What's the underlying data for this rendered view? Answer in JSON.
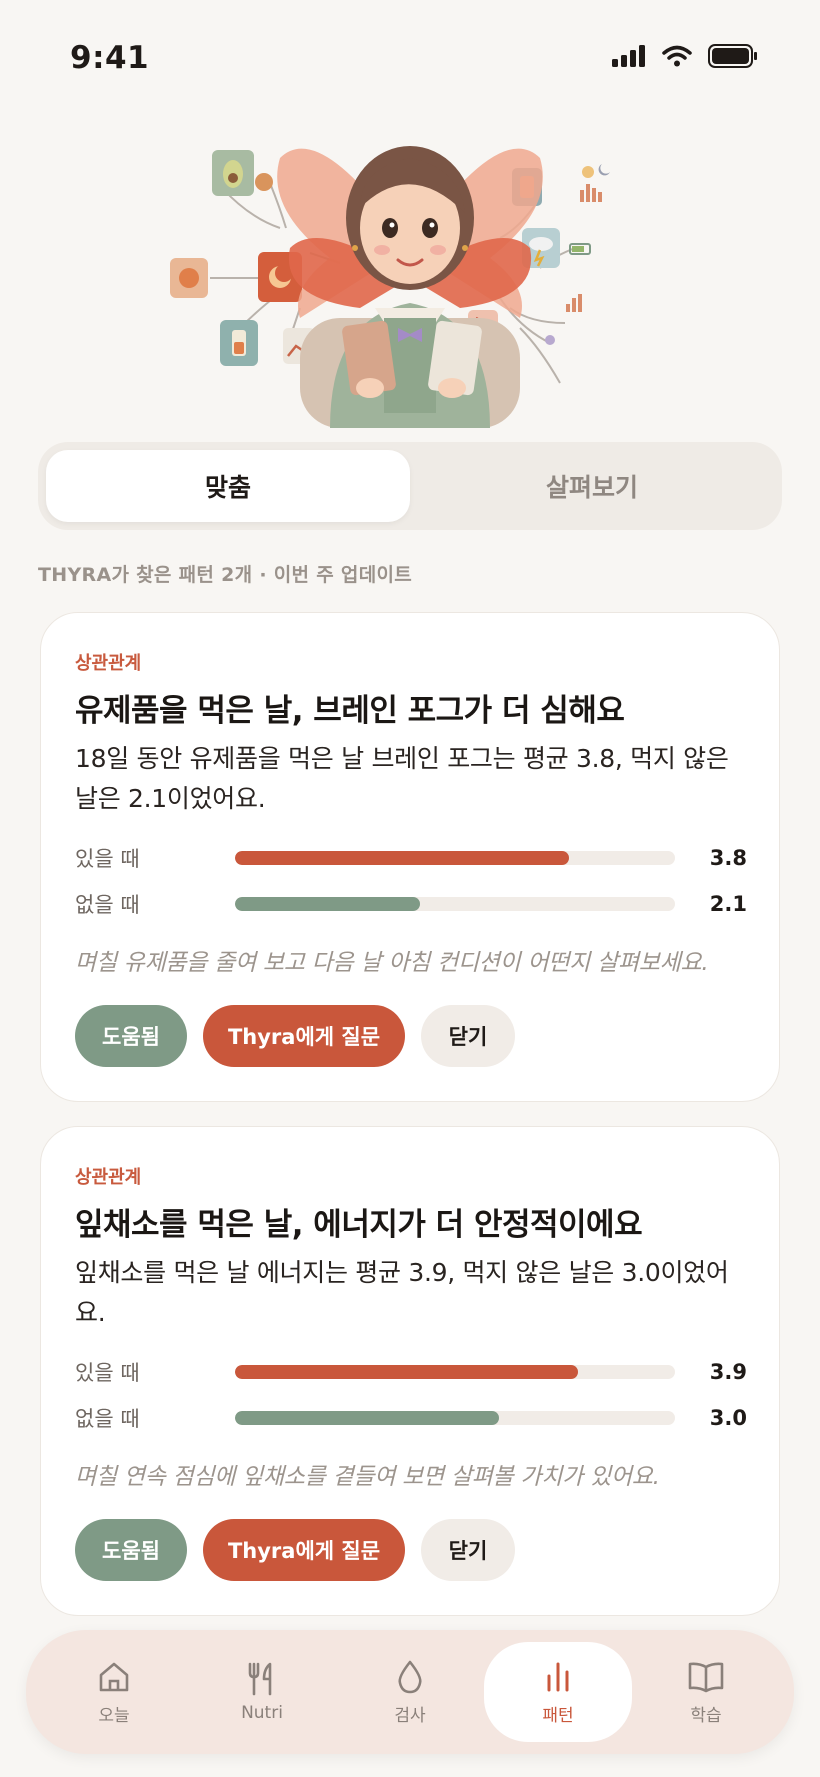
{
  "status": {
    "time": "9:41"
  },
  "segment": {
    "tabs": [
      "맞춤",
      "살펴보기"
    ],
    "active": 0
  },
  "summary": "THYRA가 찾은 패턴 2개 · 이번 주 업데이트",
  "cards": [
    {
      "tag": "상관관계",
      "title": "유제품을 먹은 날, 브레인 포그가 더 심해요",
      "description": "18일 동안 유제품을 먹은 날 브레인 포그는 평균 3.8, 먹지 않은 날은 2.1이었어요.",
      "bars": [
        {
          "label": "있을 때",
          "value": "3.8",
          "fraction": 0.76
        },
        {
          "label": "없을 때",
          "value": "2.1",
          "fraction": 0.42
        }
      ],
      "tip": "며칠 유제품을 줄여 보고 다음 날 아침 컨디션이 어떤지 살펴보세요.",
      "actions": {
        "helpful": "도움됨",
        "ask": "Thyra에게 질문",
        "close": "닫기"
      }
    },
    {
      "tag": "상관관계",
      "title": "잎채소를 먹은 날, 에너지가 더 안정적이에요",
      "description": "잎채소를 먹은 날 에너지는 평균 3.9, 먹지 않은 날은 3.0이었어요.",
      "bars": [
        {
          "label": "있을 때",
          "value": "3.9",
          "fraction": 0.78
        },
        {
          "label": "없을 때",
          "value": "3.0",
          "fraction": 0.6
        }
      ],
      "tip": "며칠 연속 점심에 잎채소를 곁들여 보면 살펴볼 가치가 있어요.",
      "actions": {
        "helpful": "도움됨",
        "ask": "Thyra에게 질문",
        "close": "닫기"
      }
    }
  ],
  "nav": {
    "items": [
      {
        "label": "오늘",
        "icon": "home-icon"
      },
      {
        "label": "Nutri",
        "icon": "utensils-icon"
      },
      {
        "label": "검사",
        "icon": "drop-icon"
      },
      {
        "label": "패턴",
        "icon": "bar-chart-icon"
      },
      {
        "label": "학습",
        "icon": "book-icon"
      }
    ],
    "active": 3
  },
  "colors": {
    "accent": "#c9573b",
    "sage": "#7f9a86",
    "background": "#f8f6f3",
    "nav_background": "#f4e6e0"
  }
}
